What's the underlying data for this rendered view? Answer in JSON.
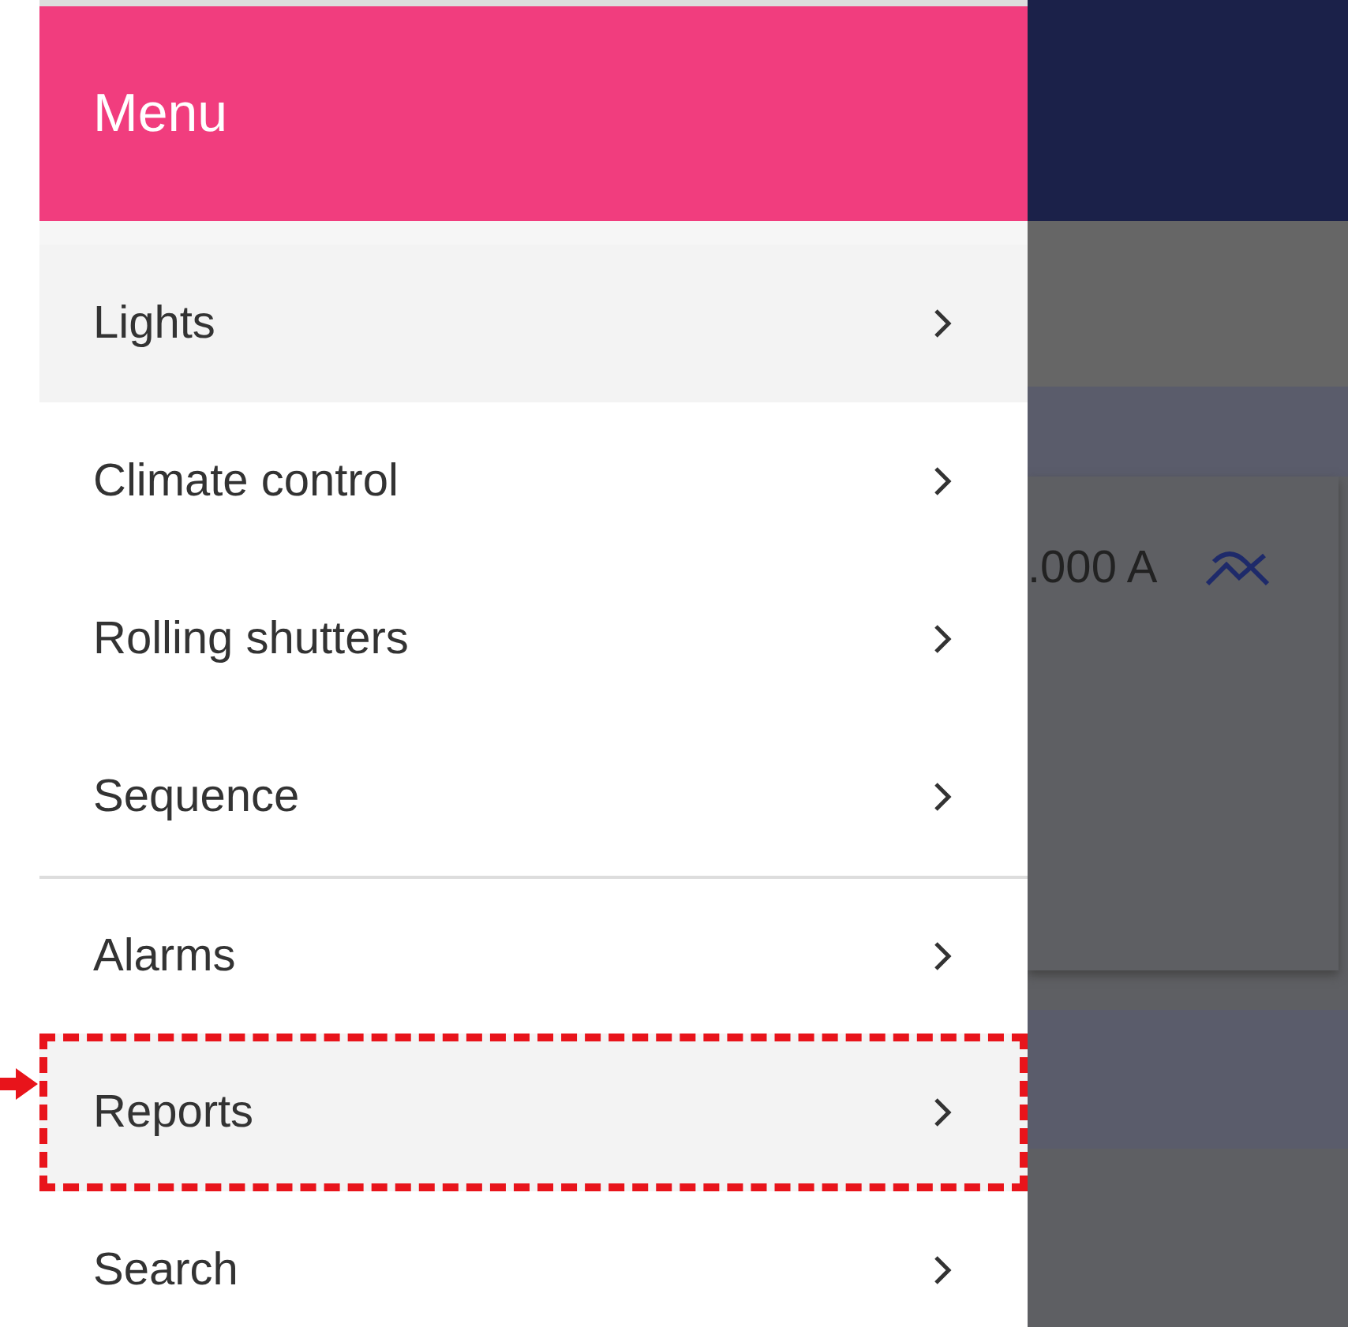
{
  "menu": {
    "title": "Menu",
    "items": [
      {
        "label": "Lights",
        "highlighted": true,
        "divider_before": false,
        "marked": false
      },
      {
        "label": "Climate control",
        "highlighted": false,
        "divider_before": false,
        "marked": false
      },
      {
        "label": "Rolling shutters",
        "highlighted": false,
        "divider_before": false,
        "marked": false
      },
      {
        "label": "Sequence",
        "highlighted": false,
        "divider_before": false,
        "marked": false
      },
      {
        "label": "Alarms",
        "highlighted": false,
        "divider_before": true,
        "marked": false
      },
      {
        "label": "Reports",
        "highlighted": true,
        "divider_before": false,
        "marked": true
      },
      {
        "label": "Search",
        "highlighted": false,
        "divider_before": false,
        "marked": false
      }
    ]
  },
  "background": {
    "reading": ".000 A"
  }
}
